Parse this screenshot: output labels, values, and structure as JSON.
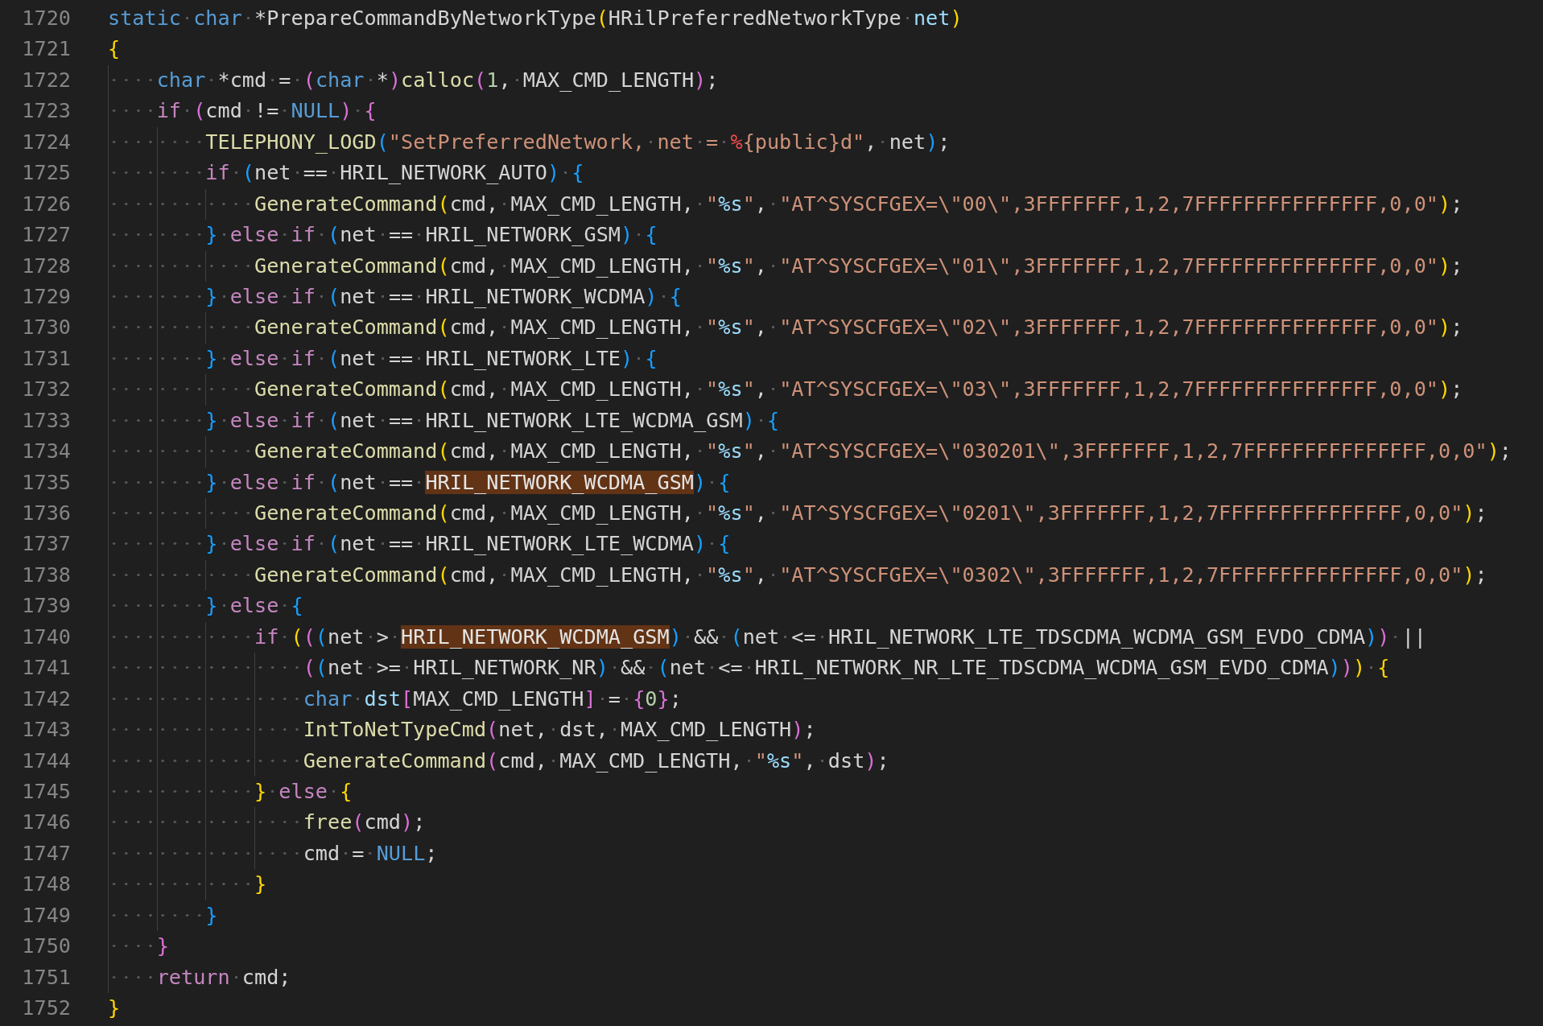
{
  "editor": {
    "lines": [
      {
        "number": "1720",
        "tokens": [
          {
            "text": "static",
            "kind": "keyword"
          },
          {
            "text": " char",
            "kind": "keyword"
          },
          {
            "text": " *PrepareCommandByNetworkType",
            "kind": "plain"
          },
          {
            "text": "(",
            "kind": "bracket1"
          },
          {
            "text": "HRilPreferredNetworkType ",
            "kind": "plain"
          },
          {
            "text": "net",
            "kind": "param"
          },
          {
            "text": ")",
            "kind": "bracket1"
          }
        ]
      },
      {
        "number": "1721",
        "tokens": [
          {
            "text": "{",
            "kind": "bracket1"
          }
        ]
      },
      {
        "number": "1722",
        "tokens": [
          {
            "text": "    char",
            "kind": "keyword"
          },
          {
            "text": " *cmd = ",
            "kind": "plain"
          },
          {
            "text": "(",
            "kind": "bracket2"
          },
          {
            "text": "char",
            "kind": "keyword"
          },
          {
            "text": " *",
            "kind": "plain"
          },
          {
            "text": ")",
            "kind": "bracket2"
          },
          {
            "text": "calloc",
            "kind": "function"
          },
          {
            "text": "(",
            "kind": "bracket2"
          },
          {
            "text": "1",
            "kind": "number"
          },
          {
            "text": ", MAX_CMD_LENGTH",
            "kind": "plain"
          },
          {
            "text": ")",
            "kind": "bracket2"
          },
          {
            "text": ";",
            "kind": "plain"
          }
        ]
      },
      {
        "number": "1723",
        "tokens": [
          {
            "text": "    if",
            "kind": "control"
          },
          {
            "text": " (",
            "kind": "bracket2"
          },
          {
            "text": "cmd != ",
            "kind": "plain"
          },
          {
            "text": "NULL",
            "kind": "keyword"
          },
          {
            "text": ")",
            "kind": "bracket2"
          },
          {
            "text": " {",
            "kind": "bracket2"
          }
        ]
      },
      {
        "number": "1724",
        "tokens": [
          {
            "text": "        TELEPHONY_LOGD",
            "kind": "function"
          },
          {
            "text": "(",
            "kind": "bracket3"
          },
          {
            "text": "\"SetPreferredNetwork, net = ",
            "kind": "string"
          },
          {
            "text": "%",
            "kind": "percent"
          },
          {
            "text": "{public}d\"",
            "kind": "string"
          },
          {
            "text": ", net",
            "kind": "plain"
          },
          {
            "text": ")",
            "kind": "bracket3"
          },
          {
            "text": ";",
            "kind": "plain"
          }
        ]
      },
      {
        "number": "1725",
        "tokens": [
          {
            "text": "        if",
            "kind": "control"
          },
          {
            "text": " (",
            "kind": "bracket3"
          },
          {
            "text": "net == HRIL_NETWORK_AUTO",
            "kind": "plain"
          },
          {
            "text": ")",
            "kind": "bracket3"
          },
          {
            "text": " {",
            "kind": "bracket3"
          }
        ]
      },
      {
        "number": "1726",
        "tokens": [
          {
            "text": "            GenerateCommand",
            "kind": "function"
          },
          {
            "text": "(",
            "kind": "bracket1"
          },
          {
            "text": "cmd, MAX_CMD_LENGTH, ",
            "kind": "plain"
          },
          {
            "text": "\"",
            "kind": "string"
          },
          {
            "text": "%s",
            "kind": "format"
          },
          {
            "text": "\"",
            "kind": "string"
          },
          {
            "text": ", ",
            "kind": "plain"
          },
          {
            "text": "\"AT^SYSCFGEX=\\\"00\\\",3FFFFFFF,1,2,7FFFFFFFFFFFFFFF,0,0\"",
            "kind": "string"
          },
          {
            "text": ")",
            "kind": "bracket1"
          },
          {
            "text": ";",
            "kind": "plain"
          }
        ]
      },
      {
        "number": "1727",
        "tokens": [
          {
            "text": "        }",
            "kind": "bracket3"
          },
          {
            "text": " else",
            "kind": "control"
          },
          {
            "text": " if",
            "kind": "control"
          },
          {
            "text": " (",
            "kind": "bracket3"
          },
          {
            "text": "net == HRIL_NETWORK_GSM",
            "kind": "plain"
          },
          {
            "text": ")",
            "kind": "bracket3"
          },
          {
            "text": " {",
            "kind": "bracket3"
          }
        ]
      },
      {
        "number": "1728",
        "tokens": [
          {
            "text": "            GenerateCommand",
            "kind": "function"
          },
          {
            "text": "(",
            "kind": "bracket1"
          },
          {
            "text": "cmd, MAX_CMD_LENGTH, ",
            "kind": "plain"
          },
          {
            "text": "\"",
            "kind": "string"
          },
          {
            "text": "%s",
            "kind": "format"
          },
          {
            "text": "\"",
            "kind": "string"
          },
          {
            "text": ", ",
            "kind": "plain"
          },
          {
            "text": "\"AT^SYSCFGEX=\\\"01\\\",3FFFFFFF,1,2,7FFFFFFFFFFFFFFF,0,0\"",
            "kind": "string"
          },
          {
            "text": ")",
            "kind": "bracket1"
          },
          {
            "text": ";",
            "kind": "plain"
          }
        ]
      },
      {
        "number": "1729",
        "tokens": [
          {
            "text": "        }",
            "kind": "bracket3"
          },
          {
            "text": " else",
            "kind": "control"
          },
          {
            "text": " if",
            "kind": "control"
          },
          {
            "text": " (",
            "kind": "bracket3"
          },
          {
            "text": "net == HRIL_NETWORK_WCDMA",
            "kind": "plain"
          },
          {
            "text": ")",
            "kind": "bracket3"
          },
          {
            "text": " {",
            "kind": "bracket3"
          }
        ]
      },
      {
        "number": "1730",
        "tokens": [
          {
            "text": "            GenerateCommand",
            "kind": "function"
          },
          {
            "text": "(",
            "kind": "bracket1"
          },
          {
            "text": "cmd, MAX_CMD_LENGTH, ",
            "kind": "plain"
          },
          {
            "text": "\"",
            "kind": "string"
          },
          {
            "text": "%s",
            "kind": "format"
          },
          {
            "text": "\"",
            "kind": "string"
          },
          {
            "text": ", ",
            "kind": "plain"
          },
          {
            "text": "\"AT^SYSCFGEX=\\\"02\\\",3FFFFFFF,1,2,7FFFFFFFFFFFFFFF,0,0\"",
            "kind": "string"
          },
          {
            "text": ")",
            "kind": "bracket1"
          },
          {
            "text": ";",
            "kind": "plain"
          }
        ]
      },
      {
        "number": "1731",
        "tokens": [
          {
            "text": "        }",
            "kind": "bracket3"
          },
          {
            "text": " else",
            "kind": "control"
          },
          {
            "text": " if",
            "kind": "control"
          },
          {
            "text": " (",
            "kind": "bracket3"
          },
          {
            "text": "net == HRIL_NETWORK_LTE",
            "kind": "plain"
          },
          {
            "text": ")",
            "kind": "bracket3"
          },
          {
            "text": " {",
            "kind": "bracket3"
          }
        ]
      },
      {
        "number": "1732",
        "tokens": [
          {
            "text": "            GenerateCommand",
            "kind": "function"
          },
          {
            "text": "(",
            "kind": "bracket1"
          },
          {
            "text": "cmd, MAX_CMD_LENGTH, ",
            "kind": "plain"
          },
          {
            "text": "\"",
            "kind": "string"
          },
          {
            "text": "%s",
            "kind": "format"
          },
          {
            "text": "\"",
            "kind": "string"
          },
          {
            "text": ", ",
            "kind": "plain"
          },
          {
            "text": "\"AT^SYSCFGEX=\\\"03\\\",3FFFFFFF,1,2,7FFFFFFFFFFFFFFF,0,0\"",
            "kind": "string"
          },
          {
            "text": ")",
            "kind": "bracket1"
          },
          {
            "text": ";",
            "kind": "plain"
          }
        ]
      },
      {
        "number": "1733",
        "tokens": [
          {
            "text": "        }",
            "kind": "bracket3"
          },
          {
            "text": " else",
            "kind": "control"
          },
          {
            "text": " if",
            "kind": "control"
          },
          {
            "text": " (",
            "kind": "bracket3"
          },
          {
            "text": "net == HRIL_NETWORK_LTE_WCDMA_GSM",
            "kind": "plain"
          },
          {
            "text": ")",
            "kind": "bracket3"
          },
          {
            "text": " {",
            "kind": "bracket3"
          }
        ]
      },
      {
        "number": "1734",
        "tokens": [
          {
            "text": "            GenerateCommand",
            "kind": "function"
          },
          {
            "text": "(",
            "kind": "bracket1"
          },
          {
            "text": "cmd, MAX_CMD_LENGTH, ",
            "kind": "plain"
          },
          {
            "text": "\"",
            "kind": "string"
          },
          {
            "text": "%s",
            "kind": "format"
          },
          {
            "text": "\"",
            "kind": "string"
          },
          {
            "text": ", ",
            "kind": "plain"
          },
          {
            "text": "\"AT^SYSCFGEX=\\\"030201\\\",3FFFFFFF,1,2,7FFFFFFFFFFFFFFF,0,0\"",
            "kind": "string"
          },
          {
            "text": ")",
            "kind": "bracket1"
          },
          {
            "text": ";",
            "kind": "plain"
          }
        ]
      },
      {
        "number": "1735",
        "tokens": [
          {
            "text": "        }",
            "kind": "bracket3"
          },
          {
            "text": " else",
            "kind": "control"
          },
          {
            "text": " if",
            "kind": "control"
          },
          {
            "text": " (",
            "kind": "bracket3"
          },
          {
            "text": "net == ",
            "kind": "plain"
          },
          {
            "text": "HRIL_NETWORK_WCDMA_GSM",
            "kind": "match"
          },
          {
            "text": ")",
            "kind": "bracket3"
          },
          {
            "text": " {",
            "kind": "bracket3"
          }
        ]
      },
      {
        "number": "1736",
        "tokens": [
          {
            "text": "            GenerateCommand",
            "kind": "function"
          },
          {
            "text": "(",
            "kind": "bracket1"
          },
          {
            "text": "cmd, MAX_CMD_LENGTH, ",
            "kind": "plain"
          },
          {
            "text": "\"",
            "kind": "string"
          },
          {
            "text": "%s",
            "kind": "format"
          },
          {
            "text": "\"",
            "kind": "string"
          },
          {
            "text": ", ",
            "kind": "plain"
          },
          {
            "text": "\"AT^SYSCFGEX=\\\"0201\\\",3FFFFFFF,1,2,7FFFFFFFFFFFFFFF,0,0\"",
            "kind": "string"
          },
          {
            "text": ")",
            "kind": "bracket1"
          },
          {
            "text": ";",
            "kind": "plain"
          }
        ]
      },
      {
        "number": "1737",
        "tokens": [
          {
            "text": "        }",
            "kind": "bracket3"
          },
          {
            "text": " else",
            "kind": "control"
          },
          {
            "text": " if",
            "kind": "control"
          },
          {
            "text": " (",
            "kind": "bracket3"
          },
          {
            "text": "net == HRIL_NETWORK_LTE_WCDMA",
            "kind": "plain"
          },
          {
            "text": ")",
            "kind": "bracket3"
          },
          {
            "text": " {",
            "kind": "bracket3"
          }
        ]
      },
      {
        "number": "1738",
        "tokens": [
          {
            "text": "            GenerateCommand",
            "kind": "function"
          },
          {
            "text": "(",
            "kind": "bracket1"
          },
          {
            "text": "cmd, MAX_CMD_LENGTH, ",
            "kind": "plain"
          },
          {
            "text": "\"",
            "kind": "string"
          },
          {
            "text": "%s",
            "kind": "format"
          },
          {
            "text": "\"",
            "kind": "string"
          },
          {
            "text": ", ",
            "kind": "plain"
          },
          {
            "text": "\"AT^SYSCFGEX=\\\"0302\\\",3FFFFFFF,1,2,7FFFFFFFFFFFFFFF,0,0\"",
            "kind": "string"
          },
          {
            "text": ")",
            "kind": "bracket1"
          },
          {
            "text": ";",
            "kind": "plain"
          }
        ]
      },
      {
        "number": "1739",
        "tokens": [
          {
            "text": "        }",
            "kind": "bracket3"
          },
          {
            "text": " else",
            "kind": "control"
          },
          {
            "text": " {",
            "kind": "bracket3"
          }
        ]
      },
      {
        "number": "1740",
        "tokens": [
          {
            "text": "            if",
            "kind": "control"
          },
          {
            "text": " (",
            "kind": "bracket1"
          },
          {
            "text": "(",
            "kind": "bracket2"
          },
          {
            "text": "(",
            "kind": "bracket3"
          },
          {
            "text": "net > ",
            "kind": "plain"
          },
          {
            "text": "HRIL_NETWORK_WCDMA_GSM",
            "kind": "match"
          },
          {
            "text": ")",
            "kind": "bracket3"
          },
          {
            "text": " && ",
            "kind": "plain"
          },
          {
            "text": "(",
            "kind": "bracket3"
          },
          {
            "text": "net <= HRIL_NETWORK_LTE_TDSCDMA_WCDMA_GSM_EVDO_CDMA",
            "kind": "plain"
          },
          {
            "text": ")",
            "kind": "bracket3"
          },
          {
            "text": ")",
            "kind": "bracket2"
          },
          {
            "text": " ||",
            "kind": "plain"
          }
        ]
      },
      {
        "number": "1741",
        "tokens": [
          {
            "text": "                (",
            "kind": "bracket2"
          },
          {
            "text": "(",
            "kind": "bracket3"
          },
          {
            "text": "net >= HRIL_NETWORK_NR",
            "kind": "plain"
          },
          {
            "text": ")",
            "kind": "bracket3"
          },
          {
            "text": " && ",
            "kind": "plain"
          },
          {
            "text": "(",
            "kind": "bracket3"
          },
          {
            "text": "net <= HRIL_NETWORK_NR_LTE_TDSCDMA_WCDMA_GSM_EVDO_CDMA",
            "kind": "plain"
          },
          {
            "text": ")",
            "kind": "bracket3"
          },
          {
            "text": ")",
            "kind": "bracket2"
          },
          {
            "text": ")",
            "kind": "bracket1"
          },
          {
            "text": " {",
            "kind": "bracket1"
          }
        ]
      },
      {
        "number": "1742",
        "tokens": [
          {
            "text": "                char",
            "kind": "keyword"
          },
          {
            "text": " dst",
            "kind": "param"
          },
          {
            "text": "[",
            "kind": "bracket2"
          },
          {
            "text": "MAX_CMD_LENGTH",
            "kind": "plain"
          },
          {
            "text": "]",
            "kind": "bracket2"
          },
          {
            "text": " = ",
            "kind": "plain"
          },
          {
            "text": "{",
            "kind": "bracket2"
          },
          {
            "text": "0",
            "kind": "number"
          },
          {
            "text": "}",
            "kind": "bracket2"
          },
          {
            "text": ";",
            "kind": "plain"
          }
        ]
      },
      {
        "number": "1743",
        "tokens": [
          {
            "text": "                IntToNetTypeCmd",
            "kind": "function"
          },
          {
            "text": "(",
            "kind": "bracket2"
          },
          {
            "text": "net, dst, MAX_CMD_LENGTH",
            "kind": "plain"
          },
          {
            "text": ")",
            "kind": "bracket2"
          },
          {
            "text": ";",
            "kind": "plain"
          }
        ]
      },
      {
        "number": "1744",
        "tokens": [
          {
            "text": "                GenerateCommand",
            "kind": "function"
          },
          {
            "text": "(",
            "kind": "bracket2"
          },
          {
            "text": "cmd, MAX_CMD_LENGTH, ",
            "kind": "plain"
          },
          {
            "text": "\"",
            "kind": "string"
          },
          {
            "text": "%s",
            "kind": "format"
          },
          {
            "text": "\"",
            "kind": "string"
          },
          {
            "text": ", dst",
            "kind": "plain"
          },
          {
            "text": ")",
            "kind": "bracket2"
          },
          {
            "text": ";",
            "kind": "plain"
          }
        ]
      },
      {
        "number": "1745",
        "tokens": [
          {
            "text": "            }",
            "kind": "bracket1"
          },
          {
            "text": " else",
            "kind": "control"
          },
          {
            "text": " {",
            "kind": "bracket1"
          }
        ]
      },
      {
        "number": "1746",
        "tokens": [
          {
            "text": "                free",
            "kind": "function"
          },
          {
            "text": "(",
            "kind": "bracket2"
          },
          {
            "text": "cmd",
            "kind": "plain"
          },
          {
            "text": ")",
            "kind": "bracket2"
          },
          {
            "text": ";",
            "kind": "plain"
          }
        ]
      },
      {
        "number": "1747",
        "tokens": [
          {
            "text": "                cmd = ",
            "kind": "plain"
          },
          {
            "text": "NULL",
            "kind": "keyword"
          },
          {
            "text": ";",
            "kind": "plain"
          }
        ]
      },
      {
        "number": "1748",
        "tokens": [
          {
            "text": "            }",
            "kind": "bracket1"
          }
        ]
      },
      {
        "number": "1749",
        "tokens": [
          {
            "text": "        }",
            "kind": "bracket3"
          }
        ]
      },
      {
        "number": "1750",
        "tokens": [
          {
            "text": "    }",
            "kind": "bracket2"
          }
        ]
      },
      {
        "number": "1751",
        "tokens": [
          {
            "text": "    return",
            "kind": "control"
          },
          {
            "text": " cmd;",
            "kind": "plain"
          }
        ]
      },
      {
        "number": "1752",
        "tokens": [
          {
            "text": "}",
            "kind": "bracket1"
          }
        ]
      }
    ]
  }
}
